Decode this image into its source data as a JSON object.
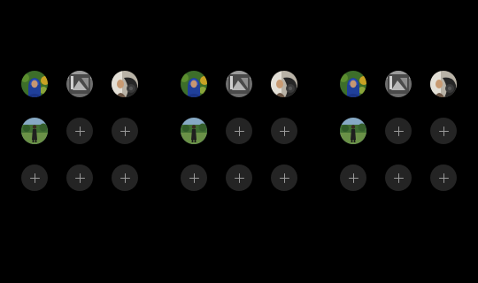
{
  "panels": [
    {
      "avatars": [
        {
          "kind": "photo",
          "icon": "profile-photo-woman-blue-hijab-icon"
        },
        {
          "kind": "photo",
          "icon": "profile-photo-grey-abstract-icon"
        },
        {
          "kind": "photo",
          "icon": "profile-photo-person-in-car-icon"
        },
        {
          "kind": "photo",
          "icon": "profile-photo-person-outdoors-icon"
        },
        {
          "kind": "add",
          "icon": "plus-icon"
        },
        {
          "kind": "add",
          "icon": "plus-icon"
        },
        {
          "kind": "add",
          "icon": "plus-icon"
        },
        {
          "kind": "add",
          "icon": "plus-icon"
        },
        {
          "kind": "add",
          "icon": "plus-icon"
        }
      ]
    },
    {
      "avatars": [
        {
          "kind": "photo",
          "icon": "profile-photo-woman-blue-hijab-icon"
        },
        {
          "kind": "photo",
          "icon": "profile-photo-grey-abstract-icon"
        },
        {
          "kind": "photo",
          "icon": "profile-photo-person-in-car-icon"
        },
        {
          "kind": "photo",
          "icon": "profile-photo-person-outdoors-icon"
        },
        {
          "kind": "add",
          "icon": "plus-icon"
        },
        {
          "kind": "add",
          "icon": "plus-icon"
        },
        {
          "kind": "add",
          "icon": "plus-icon"
        },
        {
          "kind": "add",
          "icon": "plus-icon"
        },
        {
          "kind": "add",
          "icon": "plus-icon"
        }
      ]
    },
    {
      "avatars": [
        {
          "kind": "photo",
          "icon": "profile-photo-woman-blue-hijab-icon"
        },
        {
          "kind": "photo",
          "icon": "profile-photo-grey-abstract-icon"
        },
        {
          "kind": "photo",
          "icon": "profile-photo-person-in-car-icon"
        },
        {
          "kind": "photo",
          "icon": "profile-photo-person-outdoors-icon"
        },
        {
          "kind": "add",
          "icon": "plus-icon"
        },
        {
          "kind": "add",
          "icon": "plus-icon"
        },
        {
          "kind": "add",
          "icon": "plus-icon"
        },
        {
          "kind": "add",
          "icon": "plus-icon"
        },
        {
          "kind": "add",
          "icon": "plus-icon"
        }
      ]
    }
  ],
  "colors": {
    "background": "#000000",
    "add_slot_fill": "#242424",
    "add_glyph": "#9a9a9a"
  }
}
